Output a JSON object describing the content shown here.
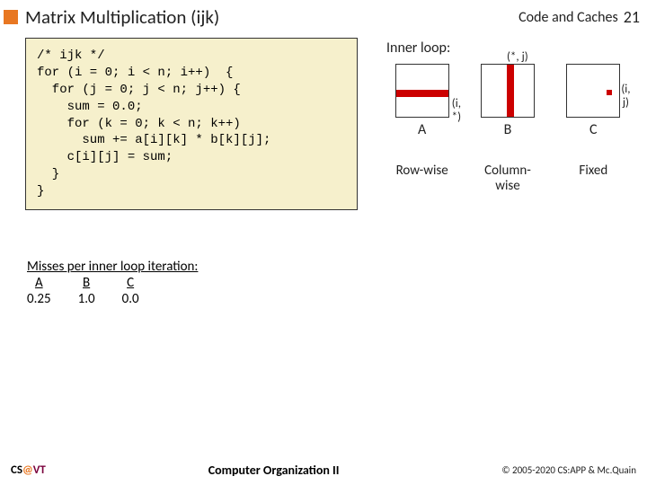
{
  "header": {
    "title": "Matrix Multiplication (ijk)",
    "subtitle": "Code and Caches",
    "slidenum": "21"
  },
  "code": "/* ijk */\nfor (i = 0; i < n; i++)  {\n  for (j = 0; j < n; j++) {\n    sum = 0.0;\n    for (k = 0; k < n; k++)\n      sum += a[i][k] * b[k][j];\n    c[i][j] = sum;\n  }\n}",
  "right": {
    "inner": "Inner loop:",
    "a_ann": "(i, *)",
    "b_ann": "(*, j)",
    "c_ann": "(i, j)",
    "A": "A",
    "B": "B",
    "C": "C",
    "patA": "Row-wise",
    "patB": "Column-\nwise",
    "patC": "Fixed"
  },
  "misses": {
    "heading": "Misses per inner loop iteration:",
    "colA": "A",
    "colB": "B",
    "colC": "C",
    "valA": "0.25",
    "valB": "1.0",
    "valC": "0.0"
  },
  "footer": {
    "cs": "CS",
    "at": "@",
    "vt": "VT",
    "course": "Computer Organization II",
    "copy": "© 2005-2020 CS:APP & Mc.Quain"
  }
}
